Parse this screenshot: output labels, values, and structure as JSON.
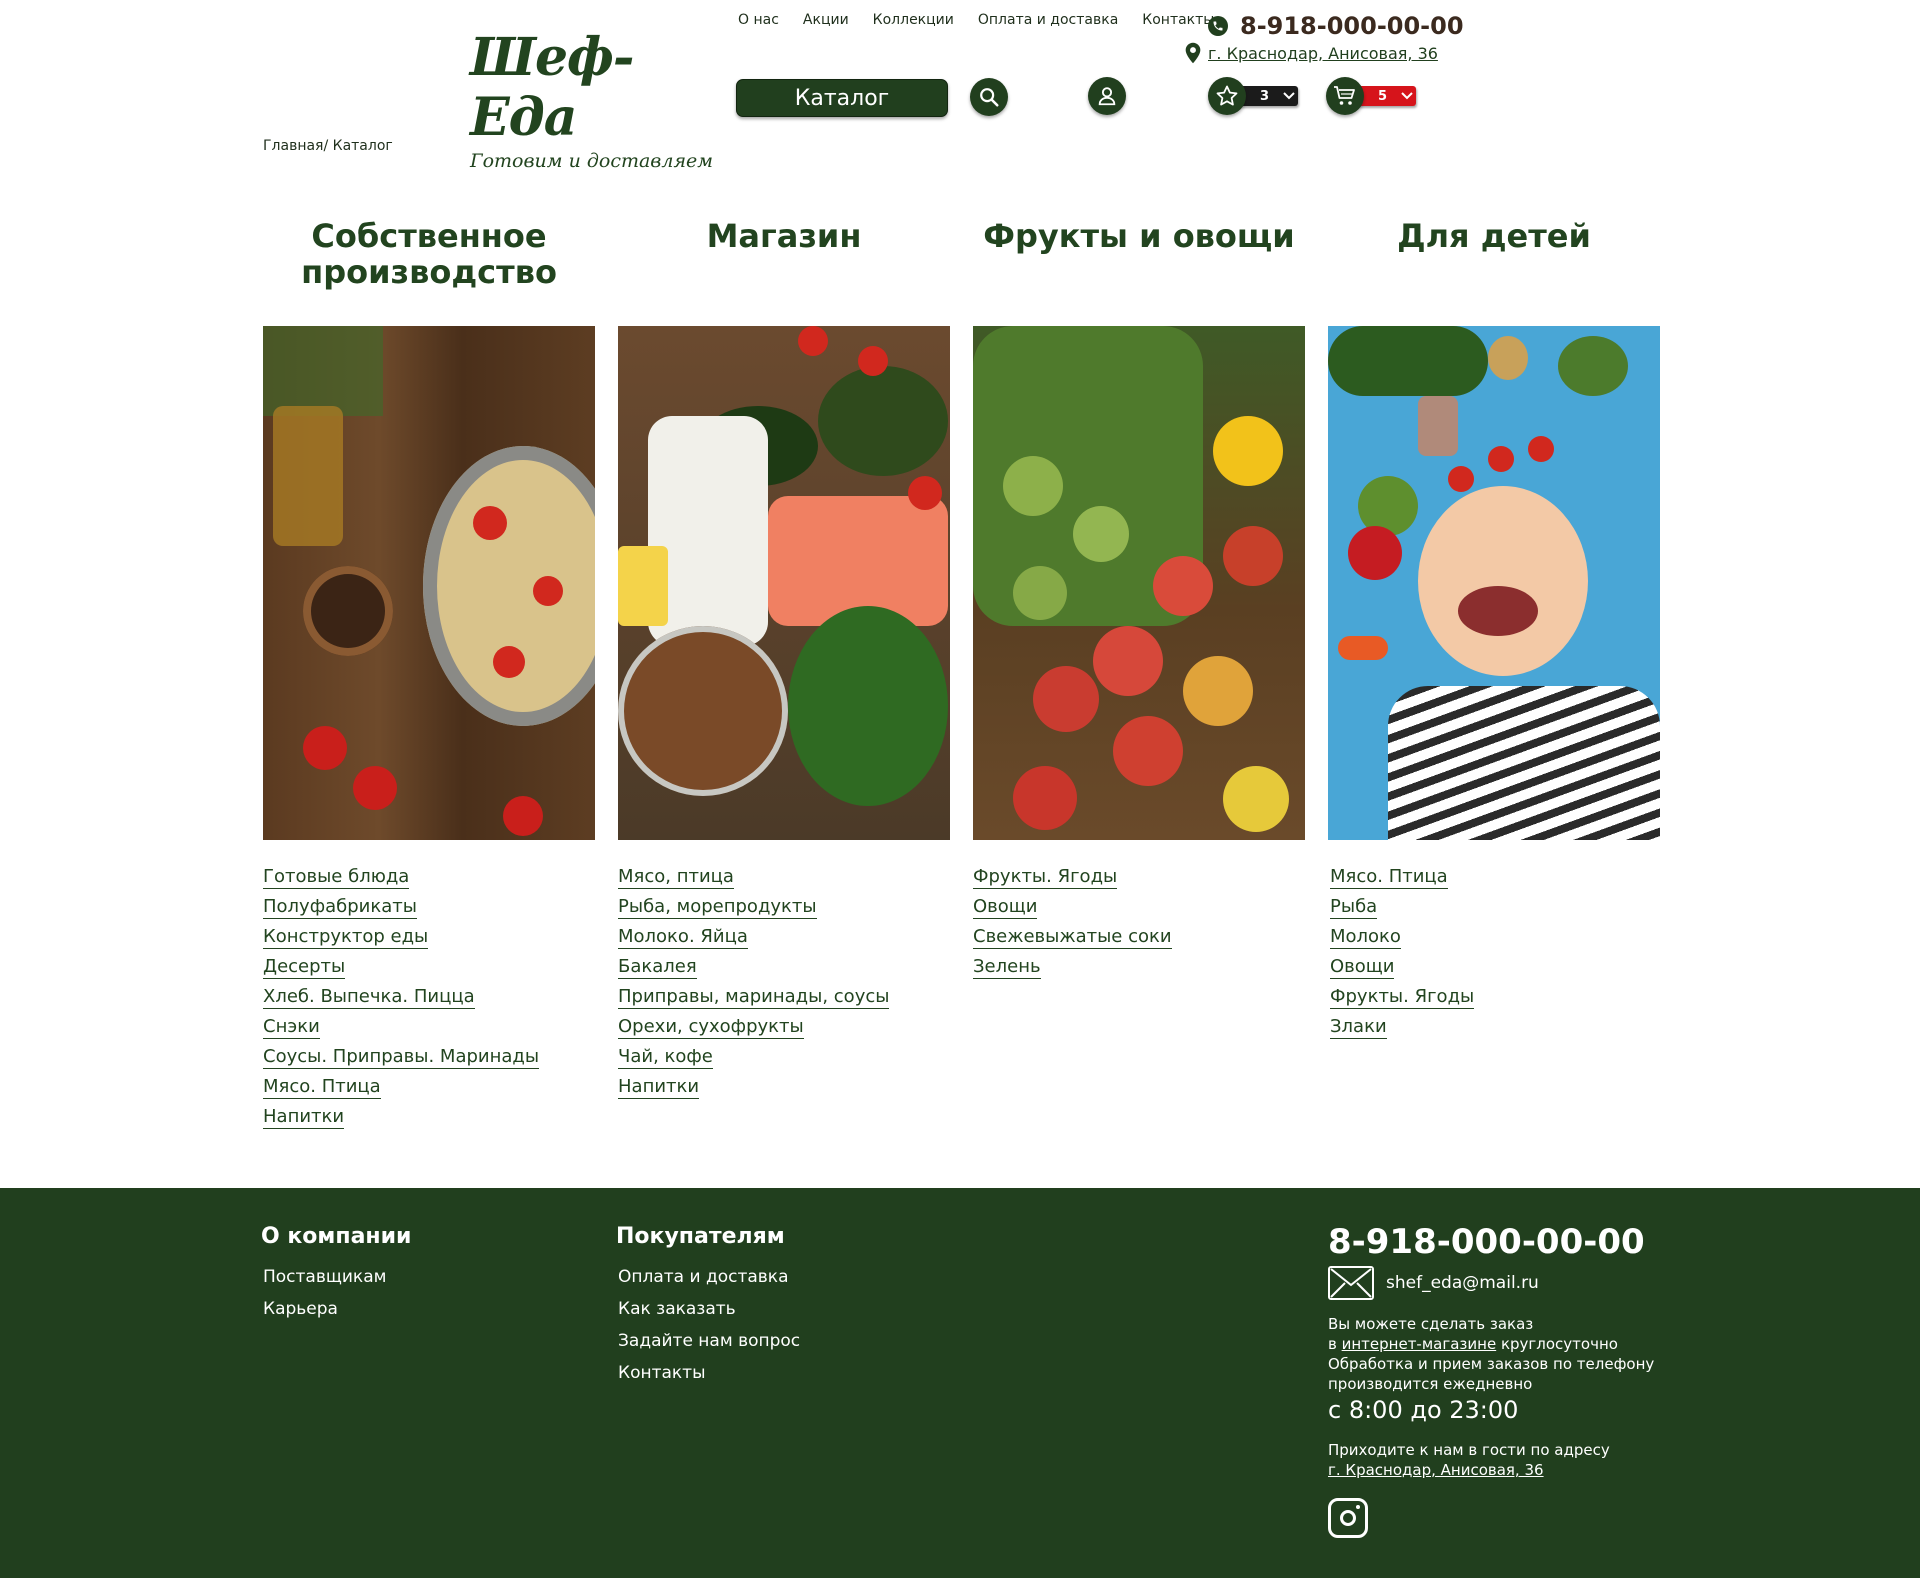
{
  "brand": {
    "name": "Шеф-Еда",
    "slogan": "Готовим и доставляем",
    "primary_color": "#213f1e",
    "accent_red": "#d6141b"
  },
  "topnav": [
    "О нас",
    "Акции",
    "Коллекции",
    "Оплата и доставка",
    "Контакты"
  ],
  "header": {
    "phone": "8-918-000-00-00",
    "address": "г. Краснодар, Анисовая, 36",
    "catalog_label": "Каталог",
    "favorites_count": "3",
    "cart_count": "5"
  },
  "breadcrumb": "Главная/ Каталог",
  "categories": [
    {
      "title": "Собственное производство",
      "links": [
        "Готовые блюда",
        "Полуфабрикаты",
        "Конструктор еды",
        "Десерты",
        "Хлеб. Выпечка. Пицца",
        "Снэки",
        "Соусы. Приправы. Маринады",
        "Мясо. Птица",
        "Напитки"
      ]
    },
    {
      "title": "Магазин",
      "links": [
        "Мясо, птица",
        "Рыба, морепродукты",
        "Молоко. Яйца",
        "Бакалея",
        "Приправы, маринады, соусы",
        "Орехи, сухофрукты",
        "Чай, кофе",
        "Напитки"
      ]
    },
    {
      "title": "Фрукты и овощи",
      "links": [
        "Фрукты. Ягоды",
        "Овощи",
        "Свежевыжатые соки",
        "Зелень"
      ]
    },
    {
      "title": "Для детей",
      "links": [
        "Мясо. Птица",
        "Рыба",
        "Молоко",
        "Овощи",
        "Фрукты. Ягоды",
        "Злаки"
      ]
    }
  ],
  "footer": {
    "company_title": "О компании",
    "company_links": [
      "Поставщикам",
      "Карьера"
    ],
    "buyers_title": "Покупателям",
    "buyers_links": [
      "Оплата и доставка",
      "Как заказать",
      "Задайте нам вопрос",
      "Контакты"
    ],
    "phone": "8-918-000-00-00",
    "email": "shef_eda@mail.ru",
    "order_text_1": "Вы можете сделать заказ",
    "order_text_2a": "в ",
    "order_link": "интернет-магазине",
    "order_text_2b": " круглосуточно",
    "order_text_3": "Обработка и прием заказов по телефону",
    "order_text_4": "производится ежедневно",
    "hours": "с 8:00 до 23:00",
    "visit_text": "Приходите к нам в гости по адресу",
    "visit_address": "г. Краснодар, Анисовая, 36"
  }
}
